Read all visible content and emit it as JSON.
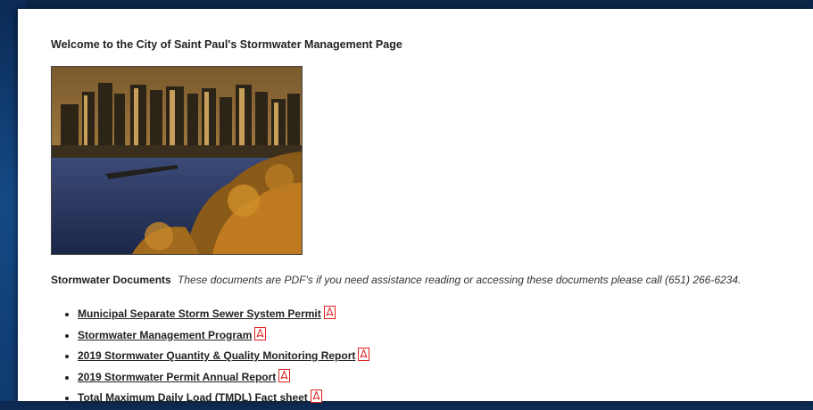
{
  "page": {
    "title": "Welcome to the City of Saint Paul's Stormwater Management Page",
    "photo_alt": "Saint Paul skyline over the Mississippi River"
  },
  "documents": {
    "heading": "Stormwater Documents",
    "note": "These documents are PDF's if you need assistance reading or accessing these documents please call (651) 266-6234.",
    "items": [
      {
        "label": "Municipal Separate Storm Sewer System Permit",
        "icon": "pdf-icon"
      },
      {
        "label": "Stormwater Management Program",
        "icon": "pdf-icon"
      },
      {
        "label": "2019 Stormwater Quantity & Quality Monitoring Report",
        "icon": "pdf-icon"
      },
      {
        "label": "2019 Stormwater Permit Annual Report",
        "icon": "pdf-icon"
      },
      {
        "label": "Total Maximum Daily Load (TMDL) Fact sheet",
        "icon": "pdf-icon"
      }
    ]
  },
  "colors": {
    "background": "#0d2a52",
    "page": "#ffffff",
    "pdf_icon": "#e02020",
    "text": "#222222"
  }
}
